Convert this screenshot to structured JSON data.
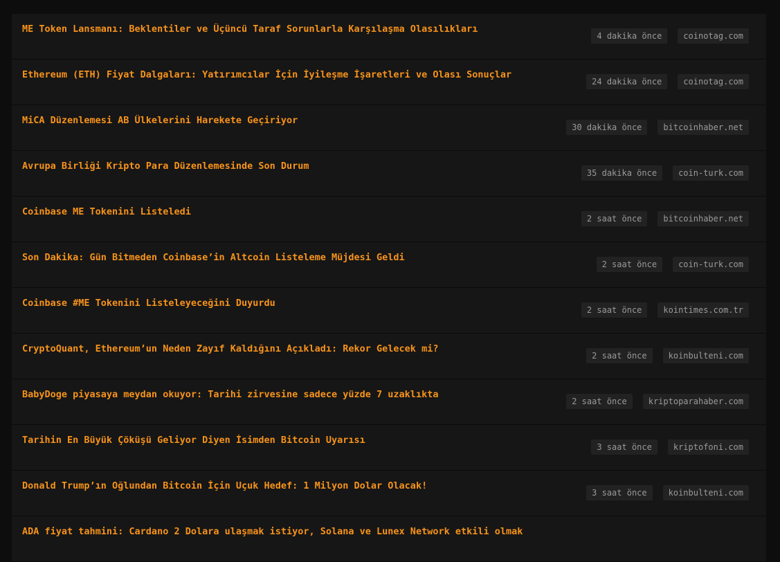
{
  "news": {
    "items": [
      {
        "title": "ME Token Lansmanı: Beklentiler ve Üçüncü Taraf Sorunlarla Karşılaşma Olasılıkları",
        "time": "4 dakika önce",
        "source": "coinotag.com"
      },
      {
        "title": "Ethereum (ETH) Fiyat Dalgaları: Yatırımcılar İçin İyileşme İşaretleri ve Olası Sonuçlar",
        "time": "24 dakika önce",
        "source": "coinotag.com"
      },
      {
        "title": "MiCA Düzenlemesi AB Ülkelerini Harekete Geçiriyor",
        "time": "30 dakika önce",
        "source": "bitcoinhaber.net"
      },
      {
        "title": "Avrupa Birliği Kripto Para Düzenlemesinde Son Durum",
        "time": "35 dakika önce",
        "source": "coin-turk.com"
      },
      {
        "title": "Coinbase ME Tokenini Listeledi",
        "time": "2 saat önce",
        "source": "bitcoinhaber.net"
      },
      {
        "title": "Son Dakika: Gün Bitmeden Coinbase’in Altcoin Listeleme Müjdesi Geldi",
        "time": "2 saat önce",
        "source": "coin-turk.com"
      },
      {
        "title": "Coinbase #ME Tokenini Listeleyeceğini Duyurdu",
        "time": "2 saat önce",
        "source": "kointimes.com.tr"
      },
      {
        "title": "CryptoQuant, Ethereum’un Neden Zayıf Kaldığını Açıkladı: Rekor Gelecek mi?",
        "time": "2 saat önce",
        "source": "koinbulteni.com"
      },
      {
        "title": "BabyDoge piyasaya meydan okuyor: Tarihi zirvesine sadece yüzde 7 uzaklıkta",
        "time": "2 saat önce",
        "source": "kriptoparahaber.com"
      },
      {
        "title": "Tarihin En Büyük Çöküşü Geliyor Diyen İsimden Bitcoin Uyarısı",
        "time": "3 saat önce",
        "source": "kriptofoni.com"
      },
      {
        "title": "Donald Trump’ın Oğlundan Bitcoin İçin Uçuk Hedef: 1 Milyon Dolar Olacak!",
        "time": "3 saat önce",
        "source": "koinbulteni.com"
      },
      {
        "title": "ADA fiyat tahmini: Cardano 2 Dolara ulaşmak istiyor, Solana ve Lunex Network etkili olmak",
        "time": "",
        "source": ""
      }
    ]
  }
}
